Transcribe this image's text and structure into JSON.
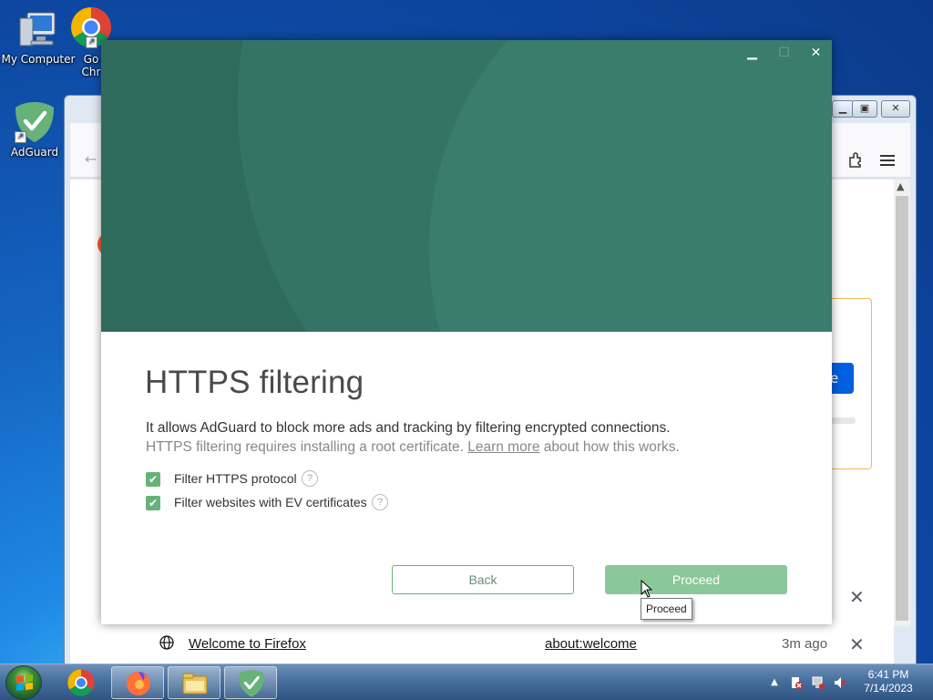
{
  "desktop": {
    "icons": [
      {
        "label": "My Computer"
      },
      {
        "label": "Go\nChr"
      },
      {
        "label": "AdGuard"
      }
    ]
  },
  "firefox": {
    "history_item": {
      "title": "Welcome to Firefox",
      "url": "about:welcome",
      "time": "3m ago"
    },
    "partial_button_text": "e"
  },
  "dialog": {
    "title": "HTTPS filtering",
    "description": "It allows AdGuard to block more ads and tracking by filtering encrypted connections.",
    "sub_prefix": "HTTPS filtering requires installing a root certificate.",
    "sub_link": "Learn more",
    "sub_suffix": "about how this works.",
    "options": [
      {
        "label": "Filter HTTPS protocol",
        "checked": true
      },
      {
        "label": "Filter websites with EV certificates",
        "checked": true
      }
    ],
    "back_label": "Back",
    "proceed_label": "Proceed",
    "tooltip": "Proceed",
    "accent": "#67b279",
    "hero_color": "#2f6b5d"
  },
  "taskbar": {
    "time": "6:41 PM",
    "date": "7/14/2023",
    "apps": [
      "chrome-icon",
      "firefox-icon",
      "file-explorer-icon",
      "adguard-icon"
    ]
  }
}
